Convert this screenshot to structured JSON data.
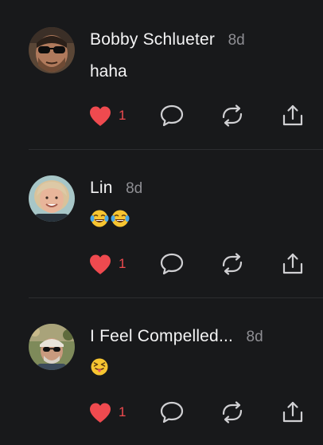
{
  "replies": [
    {
      "author": "Bobby Schlueter",
      "time": "8d",
      "text": "haha",
      "emoji": [],
      "likes": "1",
      "liked": true,
      "avatar": "avatar-bearded-man-sunglasses"
    },
    {
      "author": "Lin",
      "time": "8d",
      "text": "",
      "emoji": [
        "face-with-tears-of-joy",
        "face-with-tears-of-joy"
      ],
      "likes": "1",
      "liked": true,
      "avatar": "avatar-woman-smiling"
    },
    {
      "author": "I Feel Compelled...",
      "time": "8d",
      "text": "",
      "emoji": [
        "squinting-face-with-tongue"
      ],
      "likes": "1",
      "liked": true,
      "avatar": "avatar-man-cap-sunglasses"
    }
  ],
  "icons": {
    "like": "heart-icon",
    "comment": "speech-bubble-icon",
    "repost": "repost-arrows-icon",
    "share": "share-upload-icon"
  },
  "colors": {
    "background": "#18191b",
    "liked": "#ef4a4f",
    "icon": "#d0d0d3",
    "muted_text": "#8e8e93"
  }
}
